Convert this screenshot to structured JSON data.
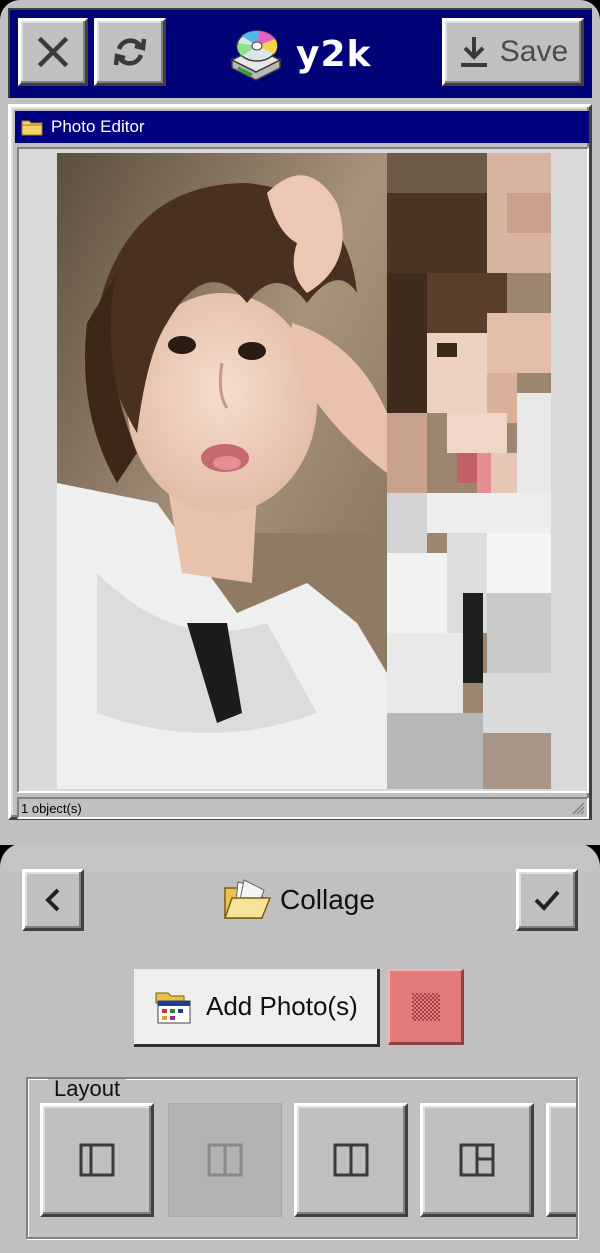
{
  "header": {
    "app_name": "y2k",
    "save_label": "Save",
    "icons": {
      "close": "close-icon",
      "refresh": "refresh-icon",
      "save": "download-icon",
      "logo": "cd-drive-icon"
    }
  },
  "editor": {
    "window_title": "Photo Editor",
    "status_text": "1 object(s)"
  },
  "panel": {
    "title": "Collage",
    "add_photos_label": "Add Photo(s)",
    "layout_label": "Layout",
    "swatch_color": "#e27b7b",
    "layout_options": [
      {
        "name": "left-panel-layout",
        "selected": false
      },
      {
        "name": "half-split-layout",
        "selected": true
      },
      {
        "name": "two-column-layout",
        "selected": false
      },
      {
        "name": "three-panel-layout",
        "selected": false
      }
    ]
  },
  "colors": {
    "title_bar": "#000080",
    "top_bar": "#020278",
    "face": "#c0c0c0"
  }
}
